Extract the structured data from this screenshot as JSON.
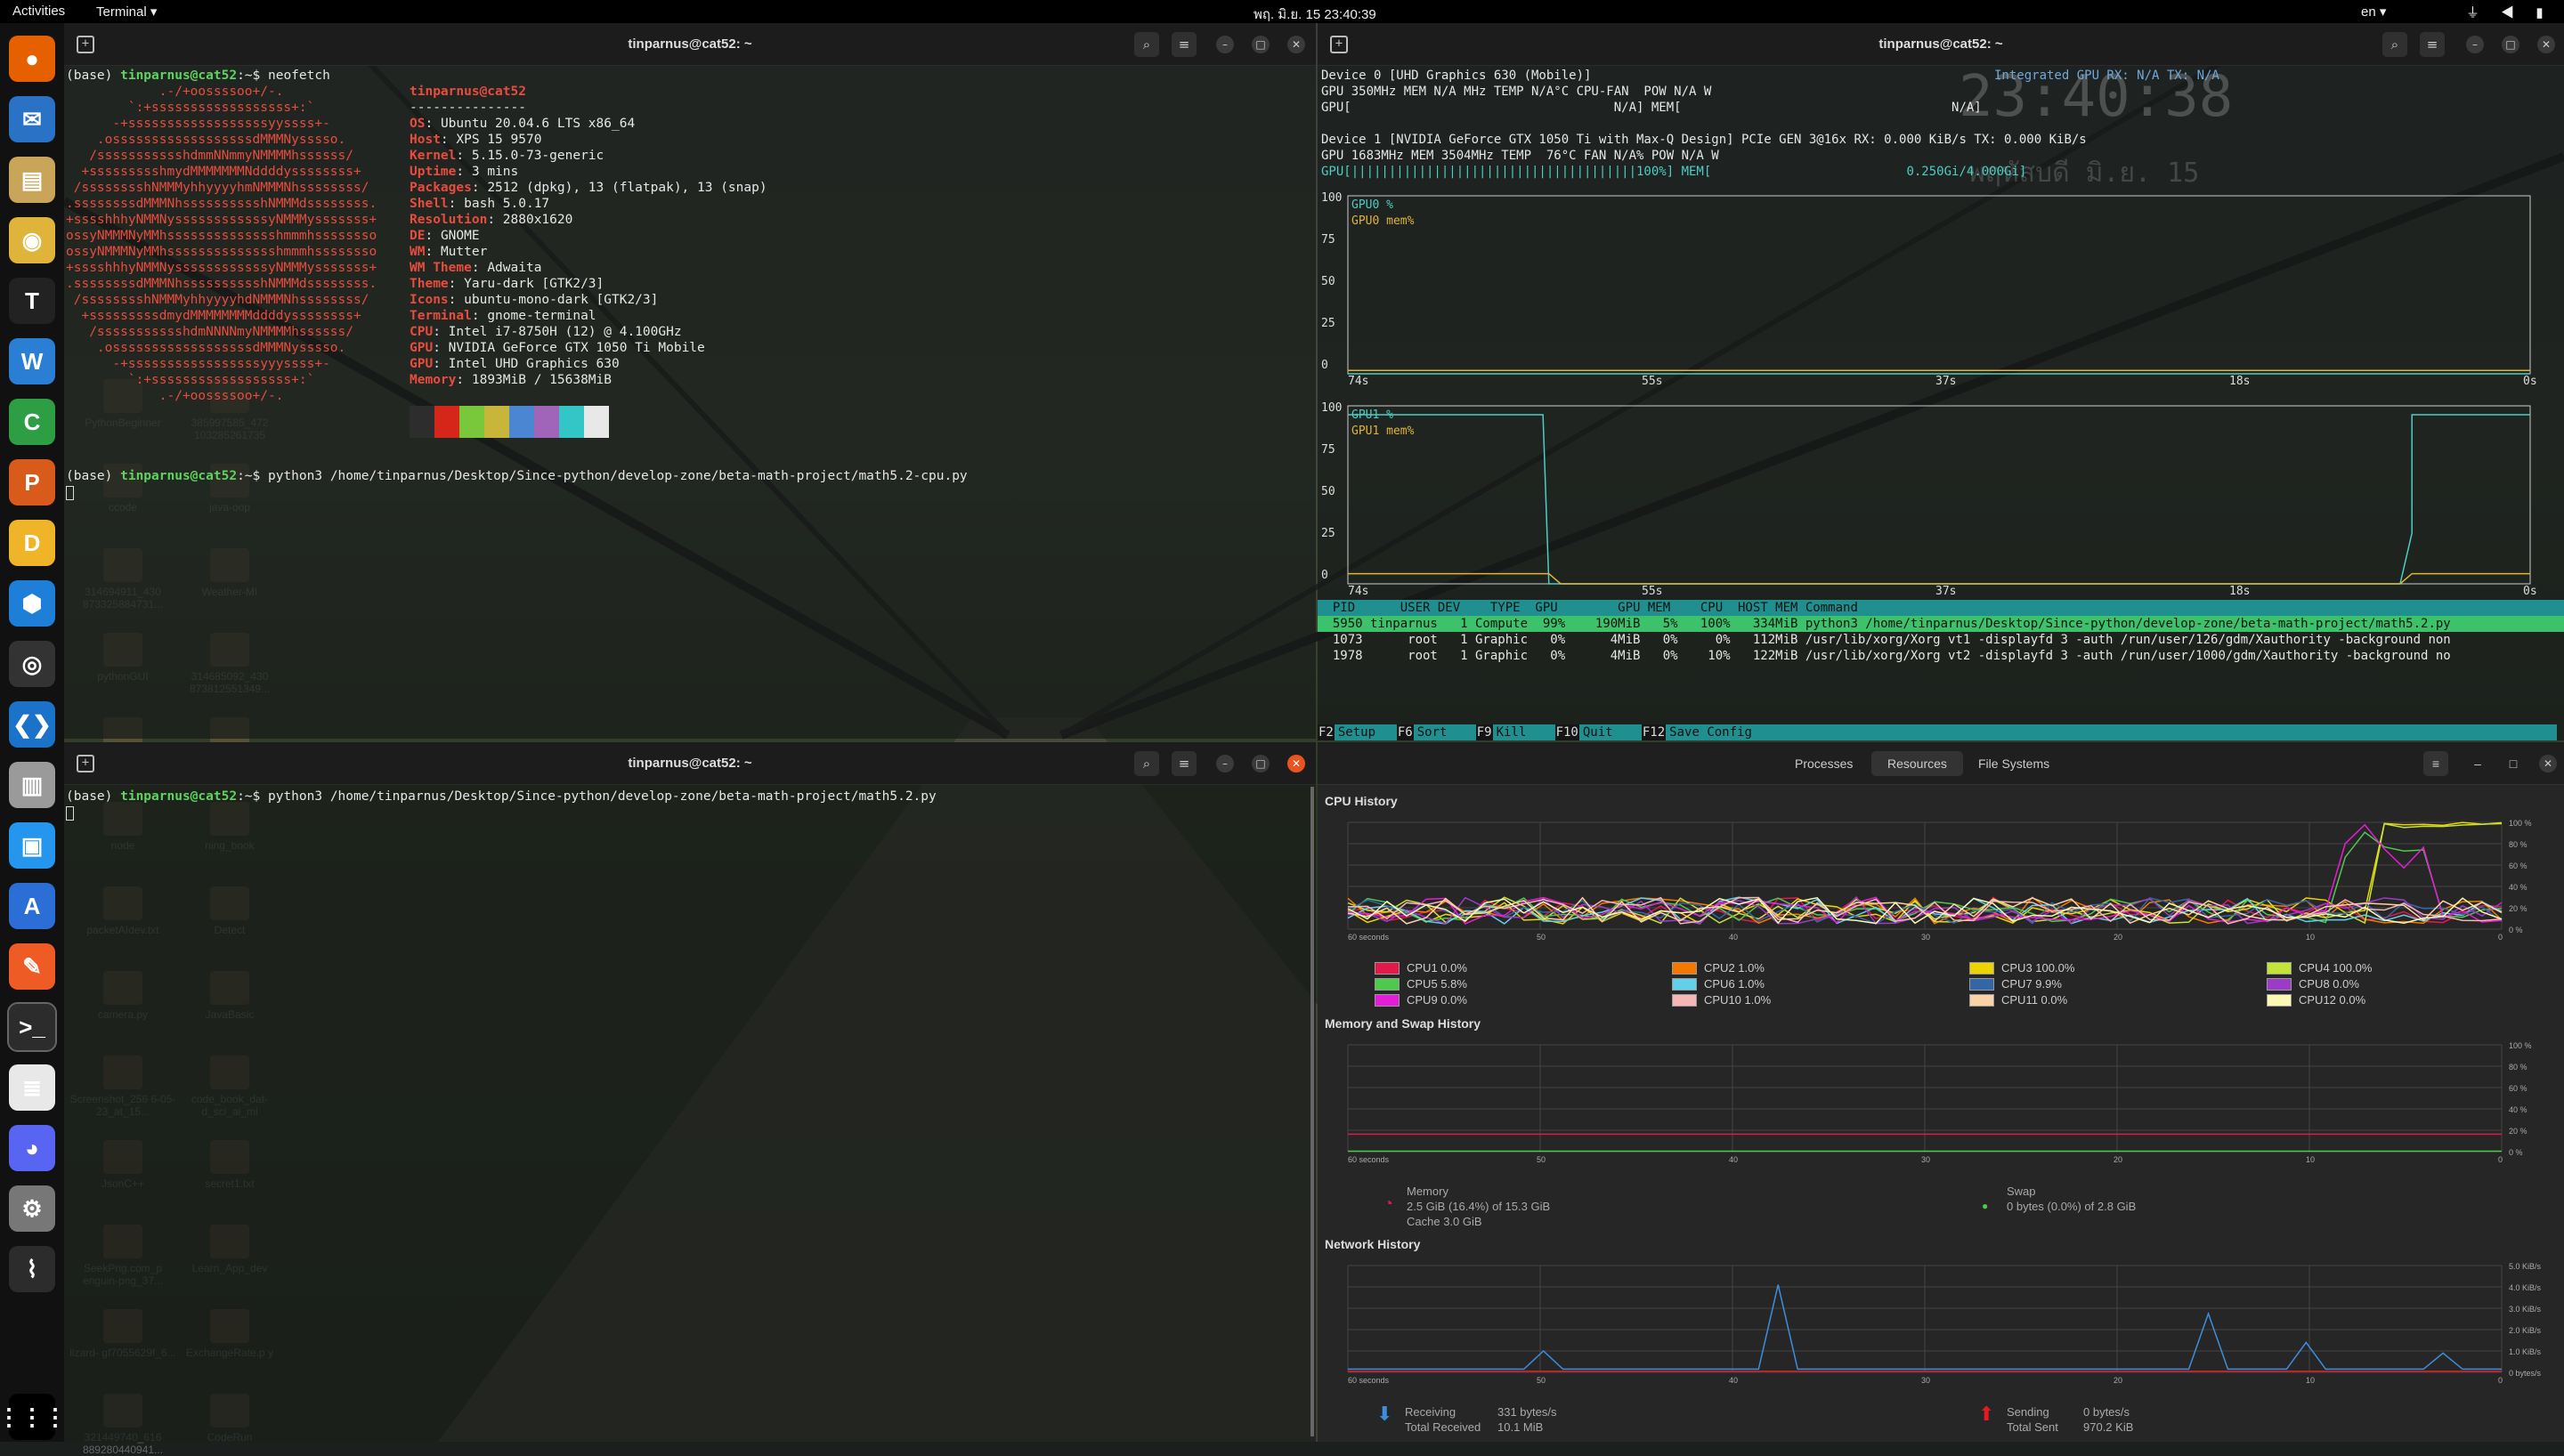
{
  "topbar": {
    "activities": "Activities",
    "app": "Terminal ▾",
    "clock": "พฤ. มิ.ย. 15  23:40:39",
    "lang": "en ▾",
    "sys": "⏚ ◀ ▮ ▾"
  },
  "dock": [
    {
      "icon": "firefox-icon",
      "glyph": "●",
      "color": "#e66000"
    },
    {
      "icon": "thunderbird-icon",
      "glyph": "✉",
      "color": "#2a72c6"
    },
    {
      "icon": "files-icon",
      "glyph": "▤",
      "color": "#c9a55a"
    },
    {
      "icon": "rhythmbox-icon",
      "glyph": "◉",
      "color": "#e0b43a"
    },
    {
      "icon": "typora-icon",
      "glyph": "T",
      "color": "#222222"
    },
    {
      "icon": "writer-icon",
      "glyph": "W",
      "color": "#2a7fd4"
    },
    {
      "icon": "calc-icon",
      "glyph": "C",
      "color": "#2e9e44"
    },
    {
      "icon": "impress-icon",
      "glyph": "P",
      "color": "#d85b1c"
    },
    {
      "icon": "draw-icon",
      "glyph": "D",
      "color": "#f0b428"
    },
    {
      "icon": "store-icon",
      "glyph": "⬢",
      "color": "#1e7fd8"
    },
    {
      "icon": "obs-icon",
      "glyph": "◎",
      "color": "#333333"
    },
    {
      "icon": "vscode-icon",
      "glyph": "❮❯",
      "color": "#1a73c8"
    },
    {
      "icon": "database-icon",
      "glyph": "▥",
      "color": "#9a9a9a"
    },
    {
      "icon": "docker-icon",
      "glyph": "▣",
      "color": "#2496ed"
    },
    {
      "icon": "app-center-icon",
      "glyph": "A",
      "color": "#2b6fd6"
    },
    {
      "icon": "postman-icon",
      "glyph": "✎",
      "color": "#ef5b25"
    },
    {
      "icon": "terminal-icon",
      "glyph": ">_",
      "color": "#2c2c2c"
    },
    {
      "icon": "text-editor-icon",
      "glyph": "≣",
      "color": "#e8e8e8"
    },
    {
      "icon": "discord-icon",
      "glyph": "◕",
      "color": "#5865f2"
    },
    {
      "icon": "settings-icon",
      "glyph": "⚙",
      "color": "#777777"
    },
    {
      "icon": "system-monitor-icon",
      "glyph": "⌇",
      "color": "#2c2c2c"
    },
    {
      "icon": "apps-grid-icon",
      "glyph": "⋮⋮⋮",
      "color": "#000000"
    }
  ],
  "desktop_icons": [
    "PythonBeginner",
    "385997585_472 103285261735",
    "ccode",
    "java-oop",
    "314694911_430 873325884731...",
    "Weather-MI",
    "pythonGUI",
    "314685092_430 873812551349...",
    "Book store",
    "Tux_Enhanced.s vg.png",
    "node",
    "ning_book",
    "packetAIdev.txt",
    "Detect",
    "camera.py",
    "JavaBasic",
    "Screenshot_256 6-05-23_at_15...",
    "code_book_dat- d_sci_ai_ml",
    "JsonC++",
    "secret1.txt",
    "SeekPng.com_p enguin-png_37...",
    "Learn_App_dev",
    "lizard- gf7055629f_6...",
    "ExchangeRate.p y",
    "321449740_616 889280440941...",
    "CodeRun"
  ],
  "term1": {
    "title": "tinparnus@cat52: ~",
    "prompt_prefix": "(base) ",
    "user": "tinparnus@cat52",
    "prompt_suffix": ":~$ ",
    "cmd1": "neofetch",
    "logo": [
      "            .-/+oossssoo+/-.",
      "        `:+ssssssssssssssssss+:`",
      "      -+ssssssssssssssssssyyssss+-",
      "    .ossssssssssssssssssdMMMNysssso.",
      "   /ssssssssssshdmmNNmmyNMMMMhssssss/",
      "  +ssssssssshmydMMMMMMMNddddyssssssss+",
      " /sssssssshNMMMyhhyyyyhmNMMMNhssssssss/",
      ".ssssssssdMMMNhsssssssssshNMMMdssssssss.",
      "+sssshhhyNMMNyssssssssssssyNMMMysssssss+",
      "ossyNMMMNyMMhsssssssssssssshmmmhssssssso",
      "ossyNMMMNyMMhsssssssssssssshmmmhssssssso",
      "+sssshhhyNMMNyssssssssssssyNMMMysssssss+",
      ".ssssssssdMMMNhsssssssssshNMMMdssssssss.",
      " /sssssssshNMMMyhhyyyyhdNMMMNhssssssss/",
      "  +sssssssssdmydMMMMMMMMddddyssssssss+",
      "   /ssssssssssshdmNNNNmyNMMMMhssssss/",
      "    .ossssssssssssssssssdMMMNysssso.",
      "      -+sssssssssssssssssyyyssss+-",
      "        `:+ssssssssssssssssss+:`",
      "            .-/+oossssoo+/-."
    ],
    "info_header": "tinparnus@cat52",
    "info_sep": "---------------",
    "info": [
      {
        "k": "OS",
        "v": "Ubuntu 20.04.6 LTS x86_64"
      },
      {
        "k": "Host",
        "v": "XPS 15 9570"
      },
      {
        "k": "Kernel",
        "v": "5.15.0-73-generic"
      },
      {
        "k": "Uptime",
        "v": "3 mins"
      },
      {
        "k": "Packages",
        "v": "2512 (dpkg), 13 (flatpak), 13 (snap)"
      },
      {
        "k": "Shell",
        "v": "bash 5.0.17"
      },
      {
        "k": "Resolution",
        "v": "2880x1620"
      },
      {
        "k": "DE",
        "v": "GNOME"
      },
      {
        "k": "WM",
        "v": "Mutter"
      },
      {
        "k": "WM Theme",
        "v": "Adwaita"
      },
      {
        "k": "Theme",
        "v": "Yaru-dark [GTK2/3]"
      },
      {
        "k": "Icons",
        "v": "ubuntu-mono-dark [GTK2/3]"
      },
      {
        "k": "Terminal",
        "v": "gnome-terminal"
      },
      {
        "k": "CPU",
        "v": "Intel i7-8750H (12) @ 4.100GHz"
      },
      {
        "k": "GPU",
        "v": "NVIDIA GeForce GTX 1050 Ti Mobile"
      },
      {
        "k": "GPU",
        "v": "Intel UHD Graphics 630"
      },
      {
        "k": "Memory",
        "v": "1893MiB / 15638MiB"
      }
    ],
    "palette": [
      "#2d2d2d",
      "#d6261a",
      "#79c73a",
      "#c8b63a",
      "#4a86d1",
      "#a065b8",
      "#32c6c6",
      "#e8e8e8"
    ],
    "cmd2": "python3 /home/tinparnus/Desktop/Since-python/develop-zone/beta-math-project/math5.2-cpu.py"
  },
  "term2": {
    "title": "tinparnus@cat52: ~",
    "cmd": "python3 /home/tinparnus/Desktop/Since-python/develop-zone/beta-math-project/math5.2.py"
  },
  "nvtop": {
    "title": "tinparnus@cat52: ~",
    "dev0": "Device 0 [UHD Graphics 630 (Mobile)]",
    "dev0_int": "Integrated GPU RX: N/A TX: N/A",
    "dev0_l2": "GPU 350MHz MEM N/A MHz TEMP N/A°C CPU-FAN  POW N/A W",
    "dev0_l3": "GPU[                                   N/A] MEM[                                    N/A]",
    "dev1": "Device 1 [NVIDIA GeForce GTX 1050 Ti with Max-Q Design] PCIe GEN 3@16x RX: 0.000 KiB/s TX: 0.000 KiB/s",
    "dev1_l2": "GPU 1683MHz MEM 3504MHz TEMP  76°C FAN N/A% POW N/A W",
    "dev1_l3": "GPU[||||||||||||||||||||||||||||||||||||||100%] MEM[                          0.250Gi/4.000Gi]",
    "clock_big": "23:40:38",
    "date_big": "พฤหัสบดี มิ.ย. 15",
    "g0_legend1": "GPU0 %",
    "g0_legend2": "GPU0 mem%",
    "g1_legend1": "GPU1 %",
    "g1_legend2": "GPU1 mem%",
    "yticks": [
      "100",
      "75",
      "50",
      "25",
      "0"
    ],
    "xticks": [
      "74s",
      "55s",
      "37s",
      "18s",
      "0s"
    ],
    "table_header": "  PID      USER DEV    TYPE  GPU        GPU MEM    CPU  HOST MEM Command",
    "rows": [
      "  5950 tinparnus   1 Compute  99%    190MiB   5%   100%   334MiB python3 /home/tinparnus/Desktop/Since-python/develop-zone/beta-math-project/math5.2.py",
      "  1073      root   1 Graphic   0%      4MiB   0%     0%   112MiB /usr/lib/xorg/Xorg vt1 -displayfd 3 -auth /run/user/126/gdm/Xauthority -background non",
      "  1978      root   1 Graphic   0%      4MiB   0%    10%   122MiB /usr/lib/xorg/Xorg vt2 -displayfd 3 -auth /run/user/1000/gdm/Xauthority -background no"
    ],
    "fkeys": [
      {
        "k": "F2",
        "v": "Setup"
      },
      {
        "k": "F6",
        "v": "Sort"
      },
      {
        "k": "F9",
        "v": "Kill"
      },
      {
        "k": "F10",
        "v": "Quit"
      },
      {
        "k": "F12",
        "v": "Save Config"
      }
    ]
  },
  "sysmon": {
    "tabs": [
      "Processes",
      "Resources",
      "File Systems"
    ],
    "active_tab": "Resources",
    "cpu_title": "CPU History",
    "mem_title": "Memory and Swap History",
    "net_title": "Network History",
    "x_ticks": [
      "60 seconds",
      "50",
      "40",
      "30",
      "20",
      "10",
      "0"
    ],
    "pct_ticks": [
      "100 %",
      "80 %",
      "60 %",
      "40 %",
      "20 %",
      "0 %"
    ],
    "net_ticks": [
      "5.0 KiB/s",
      "4.0 KiB/s",
      "3.0 KiB/s",
      "2.0 KiB/s",
      "1.0 KiB/s",
      "0 bytes/s"
    ],
    "cpus": [
      {
        "label": "CPU1 0.0%",
        "color": "#e01b4c"
      },
      {
        "label": "CPU2 1.0%",
        "color": "#f57900"
      },
      {
        "label": "CPU3 100.0%",
        "color": "#edd400"
      },
      {
        "label": "CPU4 100.0%",
        "color": "#c4e339"
      },
      {
        "label": "CPU5 5.8%",
        "color": "#4ec94e"
      },
      {
        "label": "CPU6 1.0%",
        "color": "#62d0e8"
      },
      {
        "label": "CPU7 9.9%",
        "color": "#3465a4"
      },
      {
        "label": "CPU8 0.0%",
        "color": "#9b3cc6"
      },
      {
        "label": "CPU9 0.0%",
        "color": "#e41dd6"
      },
      {
        "label": "CPU10 1.0%",
        "color": "#f7b6b6"
      },
      {
        "label": "CPU11 0.0%",
        "color": "#f9d3a5"
      },
      {
        "label": "CPU12 0.0%",
        "color": "#fbf7b4"
      }
    ],
    "memory_label": "Memory",
    "memory_value": "2.5 GiB (16.4%) of 15.3 GiB",
    "memory_cache": "Cache 3.0 GiB",
    "swap_label": "Swap",
    "swap_value": "0 bytes (0.0%) of 2.8 GiB",
    "recv_label": "Receiving",
    "recv_rate": "331 bytes/s",
    "recv_total_label": "Total Received",
    "recv_total": "10.1 MiB",
    "send_label": "Sending",
    "send_rate": "0 bytes/s",
    "send_total_label": "Total Sent",
    "send_total": "970.2 KiB",
    "mem_pct": 16.4,
    "swap_pct": 0.0
  },
  "colors": {
    "ubuntu_orange": "#e95420",
    "nvtop_teal": "#1f8f8f",
    "nvtop_green": "#3cc26b"
  }
}
